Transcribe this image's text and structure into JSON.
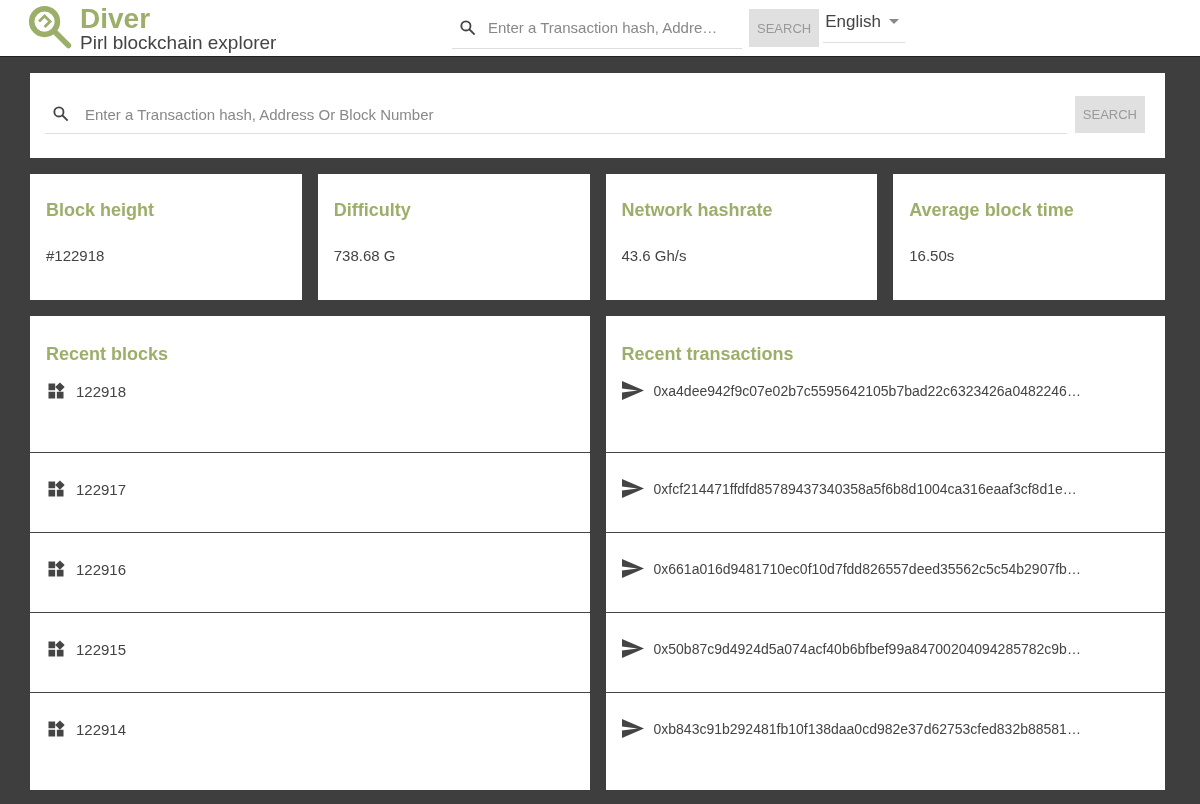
{
  "header": {
    "logo_title": "Diver",
    "logo_subtitle": "Pirl blockchain explorer",
    "search": {
      "placeholder": "Enter a Transaction hash, Addre…",
      "button": "SEARCH"
    },
    "language": "English"
  },
  "main_search": {
    "placeholder": "Enter a Transaction hash, Address Or Block Number",
    "button": "SEARCH"
  },
  "stats": [
    {
      "label": "Block height",
      "value": "#122918"
    },
    {
      "label": "Difficulty",
      "value": "738.68 G"
    },
    {
      "label": "Network hashrate",
      "value": "43.6 Gh/s"
    },
    {
      "label": "Average block time",
      "value": "16.50s"
    }
  ],
  "recent_blocks": {
    "title": "Recent blocks",
    "items": [
      "122918",
      "122917",
      "122916",
      "122915",
      "122914"
    ]
  },
  "recent_transactions": {
    "title": "Recent transactions",
    "items": [
      "0xa4dee942f9c07e02b7c5595642105b7bad22c6323426a0482246…",
      "0xfcf214471ffdfd85789437340358a5f6b8d1004ca316eaaf3cf8d1e…",
      "0x661a016d9481710ec0f10d7fdd826557deed35562c5c54b2907fb…",
      "0x50b87c9d4924d5a074acf40b6bfbef99a84700204094285782c9b…",
      "0xb843c91b292481fb10f138daa0cd982e37d62753cfed832b88581…"
    ]
  }
}
